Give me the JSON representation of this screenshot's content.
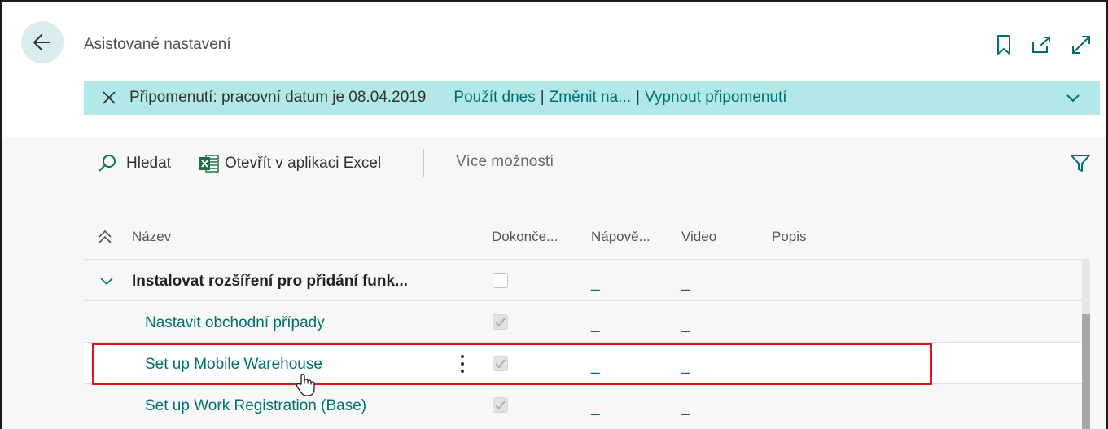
{
  "header": {
    "title": "Asistované nastavení"
  },
  "notification": {
    "message": "Připomenutí: pracovní datum je 08.04.2019",
    "actions": [
      "Použít dnes",
      "Změnit na...",
      "Vypnout připomenutí"
    ],
    "separator": "|"
  },
  "toolbar": {
    "search_label": "Hledat",
    "excel_label": "Otevřít v aplikaci Excel",
    "more_label": "Více možností"
  },
  "table": {
    "columns": [
      "Název",
      "Dokonče...",
      "Nápově...",
      "Video",
      "Popis"
    ],
    "rows": [
      {
        "name": "Instalovat rozšíření pro přidání funk...",
        "completed": false,
        "help": "_",
        "video": "_"
      },
      {
        "name": "Nastavit obchodní případy",
        "completed": true,
        "help": "_",
        "video": "_"
      },
      {
        "name": "Set up Mobile Warehouse",
        "completed": true,
        "help": "_",
        "video": "_"
      },
      {
        "name": "Set up Work Registration (Base)",
        "completed": true,
        "help": "_",
        "video": "_"
      }
    ]
  },
  "colors": {
    "accent": "#00706e",
    "notify_bg": "#b2e8e8",
    "highlight": "#e3141a"
  }
}
